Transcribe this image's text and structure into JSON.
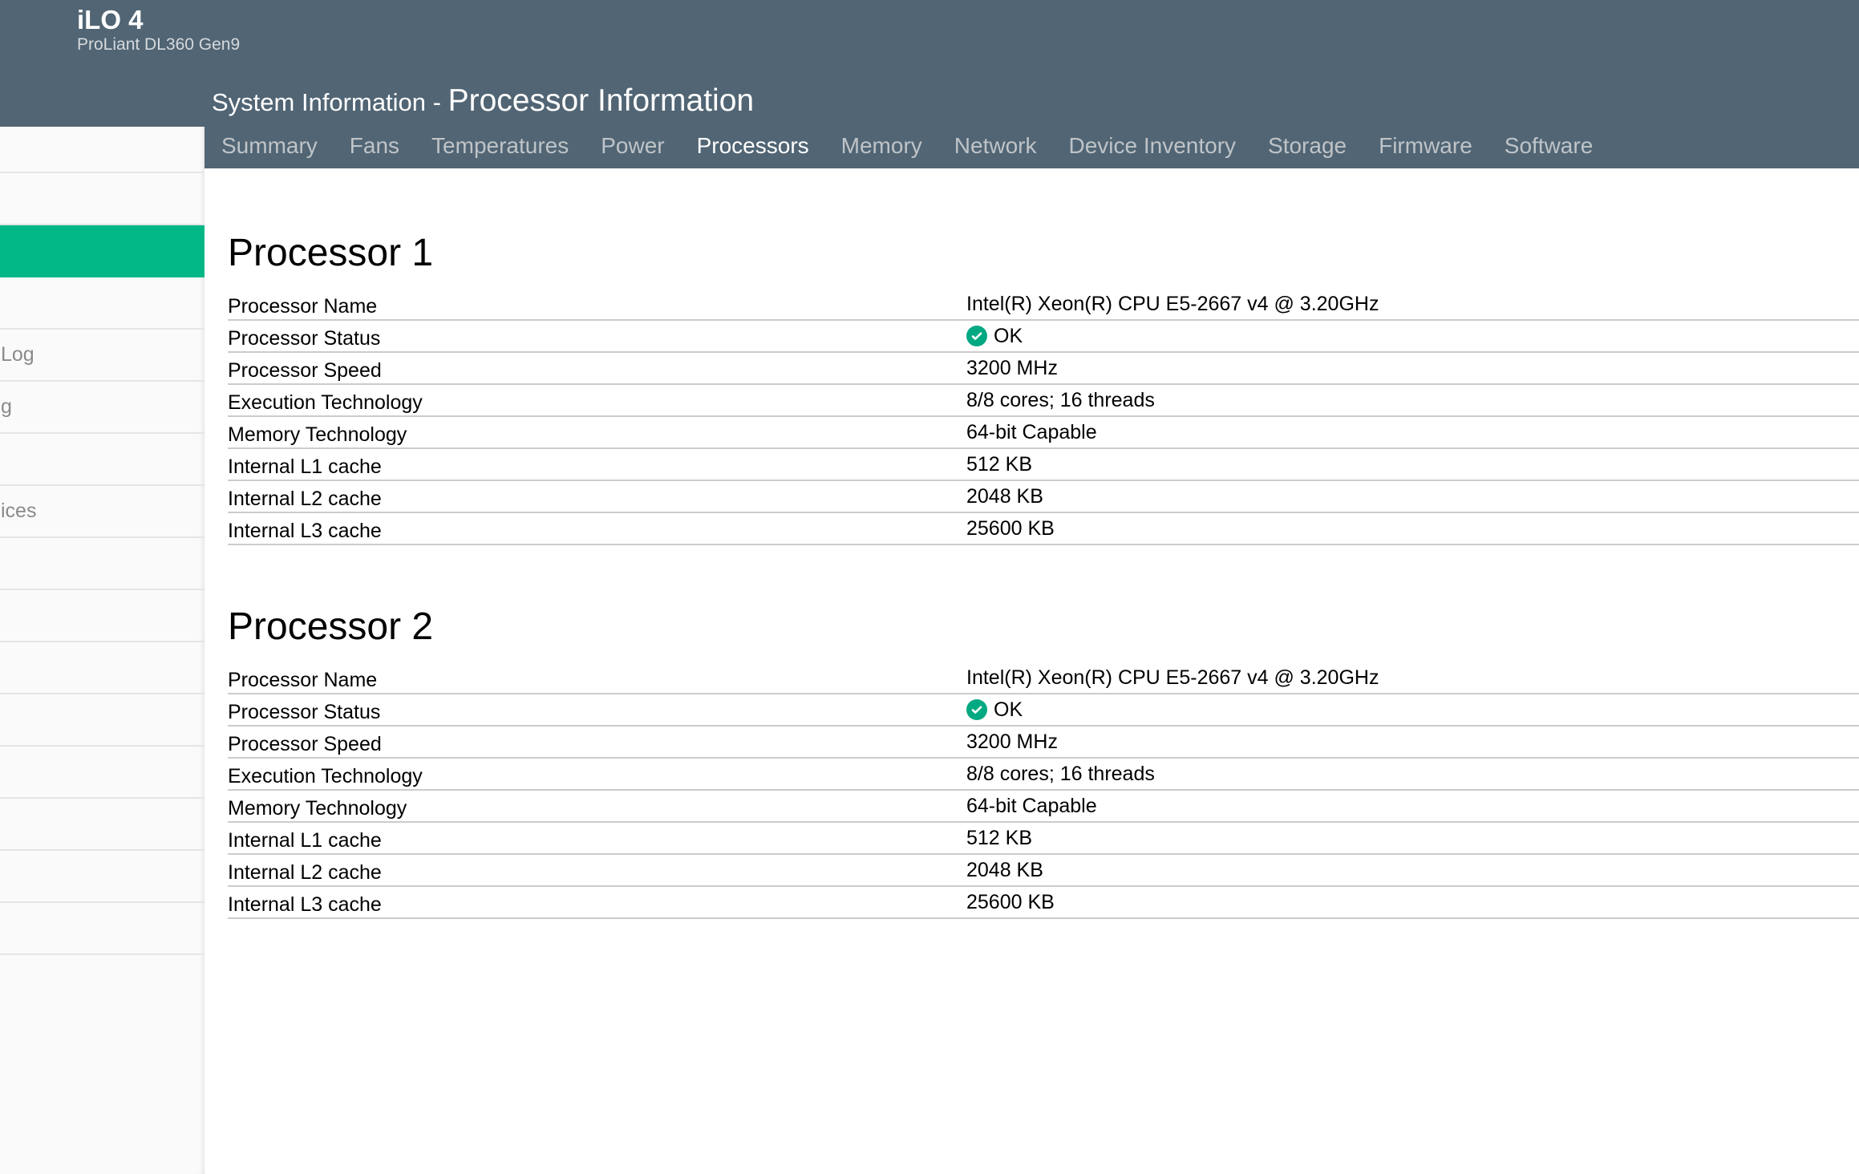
{
  "header": {
    "brand": "iLO 4",
    "model": "ProLiant DL360 Gen9",
    "section": "System Information - ",
    "page_title": "Processor Information"
  },
  "tabs": [
    {
      "label": "Summary",
      "active": false
    },
    {
      "label": "Fans",
      "active": false
    },
    {
      "label": "Temperatures",
      "active": false
    },
    {
      "label": "Power",
      "active": false
    },
    {
      "label": "Processors",
      "active": true
    },
    {
      "label": "Memory",
      "active": false
    },
    {
      "label": "Network",
      "active": false
    },
    {
      "label": "Device Inventory",
      "active": false
    },
    {
      "label": "Storage",
      "active": false
    },
    {
      "label": "Firmware",
      "active": false
    },
    {
      "label": "Software",
      "active": false
    }
  ],
  "sidebar": {
    "items": [
      "",
      "",
      "",
      "",
      "Log",
      "g",
      "",
      "ices",
      "",
      "",
      "",
      "",
      "",
      "",
      "",
      ""
    ],
    "active_index": 2
  },
  "processors": [
    {
      "title": "Processor 1",
      "rows": [
        {
          "label": "Processor Name",
          "value": "Intel(R) Xeon(R) CPU E5-2667 v4 @ 3.20GHz"
        },
        {
          "label": "Processor Status",
          "value": "OK",
          "icon": "check-circle-icon"
        },
        {
          "label": "Processor Speed",
          "value": "3200 MHz"
        },
        {
          "label": "Execution Technology",
          "value": "8/8 cores; 16 threads"
        },
        {
          "label": "Memory Technology",
          "value": "64-bit Capable"
        },
        {
          "label": "Internal L1 cache",
          "value": "512 KB"
        },
        {
          "label": "Internal L2 cache",
          "value": "2048 KB"
        },
        {
          "label": "Internal L3 cache",
          "value": "25600 KB"
        }
      ]
    },
    {
      "title": "Processor 2",
      "rows": [
        {
          "label": "Processor Name",
          "value": "Intel(R) Xeon(R) CPU E5-2667 v4 @ 3.20GHz"
        },
        {
          "label": "Processor Status",
          "value": "OK",
          "icon": "check-circle-icon"
        },
        {
          "label": "Processor Speed",
          "value": "3200 MHz"
        },
        {
          "label": "Execution Technology",
          "value": "8/8 cores; 16 threads"
        },
        {
          "label": "Memory Technology",
          "value": "64-bit Capable"
        },
        {
          "label": "Internal L1 cache",
          "value": "512 KB"
        },
        {
          "label": "Internal L2 cache",
          "value": "2048 KB"
        },
        {
          "label": "Internal L3 cache",
          "value": "25600 KB"
        }
      ]
    }
  ],
  "colors": {
    "header": "#516574",
    "accent": "#01b786",
    "status_ok": "#01a982"
  }
}
